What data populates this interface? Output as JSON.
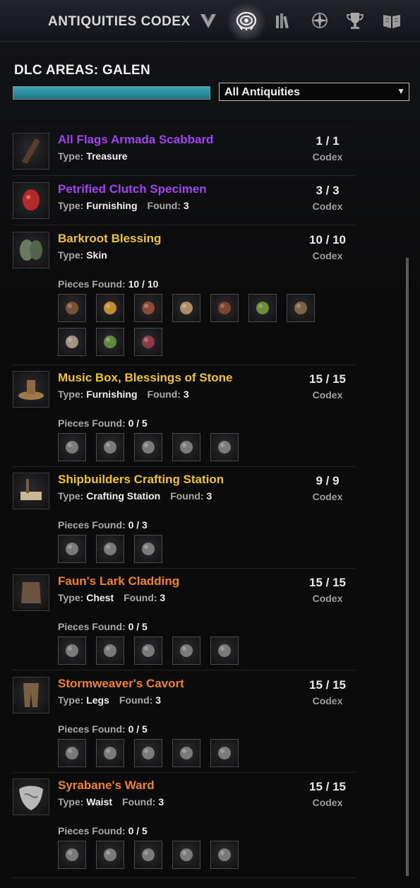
{
  "header": {
    "title": "ANTIQUITIES CODEX",
    "nav_icons": [
      "scrying-icon",
      "codex-eye-icon",
      "tomes-icon",
      "compass-icon",
      "trophy-icon",
      "journal-icon"
    ],
    "active_icon": "codex-eye-icon"
  },
  "area": {
    "title": "DLC AREAS: GALEN",
    "progress_percent": 100,
    "progress_color": "#2d93a3",
    "filter_label": "All Antiquities",
    "filter_arrow": "▼"
  },
  "colors": {
    "purple": "#a044ee",
    "gold": "#eec32e",
    "orange": "#ee8230"
  },
  "items": [
    {
      "name": "All Flags Armada Scabbard",
      "color": "purple",
      "type_label": "Type:",
      "type": "Treasure",
      "count": "1 / 1",
      "codex": "Codex",
      "icon": "scabbard-icon"
    },
    {
      "name": "Petrified Clutch Specimen",
      "color": "purple",
      "type_label": "Type:",
      "type": "Furnishing",
      "found_label": "Found:",
      "found": "3",
      "count": "3 / 3",
      "codex": "Codex",
      "icon": "egg-icon"
    },
    {
      "name": "Barkroot Blessing",
      "color": "gold",
      "type_label": "Type:",
      "type": "Skin",
      "count": "10 / 10",
      "codex": "Codex",
      "icon": "bark-mask-icon",
      "pieces_label": "Pieces Found:",
      "pieces_found": "10 / 10",
      "pieces": [
        "chest-icon",
        "crystal-icon",
        "tablet-icon",
        "bowl-icon",
        "shovel-icon",
        "vine-icon",
        "dirt-pile-icon",
        "root-icon",
        "herb-icon",
        "goblet-icon"
      ]
    },
    {
      "name": "Music Box, Blessings of Stone",
      "color": "gold",
      "type_label": "Type:",
      "type": "Furnishing",
      "found_label": "Found:",
      "found": "3",
      "count": "15 / 15",
      "codex": "Codex",
      "icon": "music-box-icon",
      "pieces_label": "Pieces Found:",
      "pieces_found": "0 / 5",
      "pieces": [
        "disc-icon",
        "pins-icon",
        "cylinder-icon",
        "crank-icon",
        "plate-icon"
      ]
    },
    {
      "name": "Shipbuilders Crafting Station",
      "color": "gold",
      "type_label": "Type:",
      "type": "Crafting Station",
      "found_label": "Found:",
      "found": "3",
      "count": "9 / 9",
      "codex": "Codex",
      "icon": "crafting-station-icon",
      "pieces_label": "Pieces Found:",
      "pieces_found": "0 / 3",
      "pieces": [
        "board-icon",
        "table-icon",
        "frame-icon"
      ]
    },
    {
      "name": "Faun's Lark Cladding",
      "color": "orange",
      "type_label": "Type:",
      "type": "Chest",
      "found_label": "Found:",
      "found": "3",
      "count": "15 / 15",
      "codex": "Codex",
      "icon": "chest-armor-icon",
      "pieces_label": "Pieces Found:",
      "pieces_found": "0 / 5",
      "pieces": [
        "vest-icon",
        "bead-necklace-icon",
        "cloth-icon",
        "ring-flower-icon",
        "hide-icon"
      ]
    },
    {
      "name": "Stormweaver's Cavort",
      "color": "orange",
      "type_label": "Type:",
      "type": "Legs",
      "found_label": "Found:",
      "found": "3",
      "count": "15 / 15",
      "codex": "Codex",
      "icon": "leggings-icon",
      "pieces_label": "Pieces Found:",
      "pieces_found": "0 / 5",
      "pieces": [
        "medallion-icon",
        "coil-icon",
        "fringe-icon",
        "spider-icon",
        "roots-icon"
      ]
    },
    {
      "name": "Syrabane's Ward",
      "color": "orange",
      "type_label": "Type:",
      "type": "Waist",
      "found_label": "Found:",
      "found": "3",
      "count": "15 / 15",
      "codex": "Codex",
      "icon": "shield-icon",
      "pieces_label": "Pieces Found:",
      "pieces_found": "0 / 5",
      "pieces": [
        "emblem-icon",
        "spool-icon",
        "kettle-icon",
        "rings-icon",
        "hammer-icon"
      ]
    }
  ]
}
